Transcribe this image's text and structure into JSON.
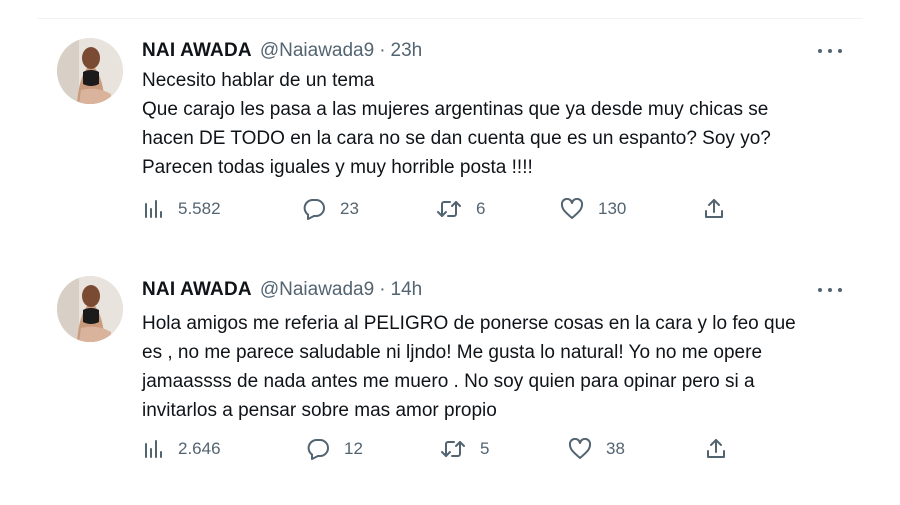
{
  "tweets": [
    {
      "name": "NAI AWADA",
      "handle": "@Naiawada9",
      "separator": "·",
      "time": "23h",
      "lines": [
        "Necesito hablar de un tema",
        "Que carajo les pasa a las mujeres argentinas que ya desde muy chicas se",
        "hacen DE TODO en la cara no se dan cuenta que es un espanto? Soy yo?",
        "Parecen todas iguales y muy horrible posta !!!!"
      ],
      "views": "5.582",
      "replies": "23",
      "retweets": "6",
      "likes": "130"
    },
    {
      "name": "NAI AWADA",
      "handle": "@Naiawada9",
      "separator": "·",
      "time": "14h",
      "lines": [
        "Hola amigos me referia al PELIGRO de ponerse cosas en la cara y lo feo que",
        "es , no me parece saludable ni ljndo! Me gusta lo natural! Yo no me opere",
        "jamaassss de nada antes me muero . No soy quien para opinar pero si a",
        "invitarlos a pensar sobre mas amor propio"
      ],
      "views": "2.646",
      "replies": "12",
      "retweets": "5",
      "likes": "38"
    }
  ],
  "icons": {
    "views": "views-icon",
    "reply": "reply-icon",
    "retweet": "retweet-icon",
    "like": "like-icon",
    "share": "share-icon",
    "more": "more-icon"
  },
  "colors": {
    "text": "#0f1419",
    "secondary": "#536471",
    "divider": "#eff3f4",
    "background": "#ffffff"
  }
}
